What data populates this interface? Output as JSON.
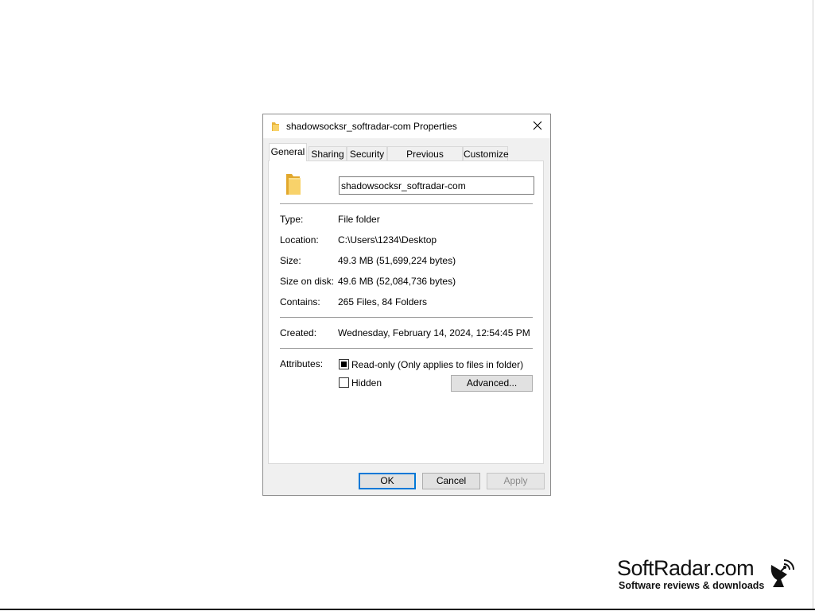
{
  "dialog": {
    "title": "shadowsocksr_softradar-com Properties",
    "tabs": [
      {
        "label": "General"
      },
      {
        "label": "Sharing"
      },
      {
        "label": "Security"
      },
      {
        "label": "Previous Versions"
      },
      {
        "label": "Customize"
      }
    ],
    "active_tab": "General",
    "folder_name": "shadowsocksr_softradar-com",
    "info": [
      {
        "label": "Type:",
        "value": "File folder"
      },
      {
        "label": "Location:",
        "value": "C:\\Users\\1234\\Desktop"
      },
      {
        "label": "Size:",
        "value": "49.3 MB (51,699,224 bytes)"
      },
      {
        "label": "Size on disk:",
        "value": "49.6 MB (52,084,736 bytes)"
      },
      {
        "label": "Contains:",
        "value": "265 Files, 84 Folders"
      }
    ],
    "created": {
      "label": "Created:",
      "value": "Wednesday, February 14, 2024, 12:54:45 PM"
    },
    "attributes": {
      "label": "Attributes:",
      "readonly": {
        "label": "Read-only (Only applies to files in folder)",
        "state": "indeterminate"
      },
      "hidden": {
        "label": "Hidden",
        "checked": false
      },
      "advanced_label": "Advanced..."
    },
    "buttons": {
      "ok": "OK",
      "cancel": "Cancel",
      "apply": "Apply"
    }
  },
  "watermark": {
    "name": "SoftRadar.com",
    "tagline": "Software reviews & downloads",
    "icon": "satellite-dish-icon"
  },
  "colors": {
    "folder": "#f5c344",
    "accent": "#0078d7"
  }
}
